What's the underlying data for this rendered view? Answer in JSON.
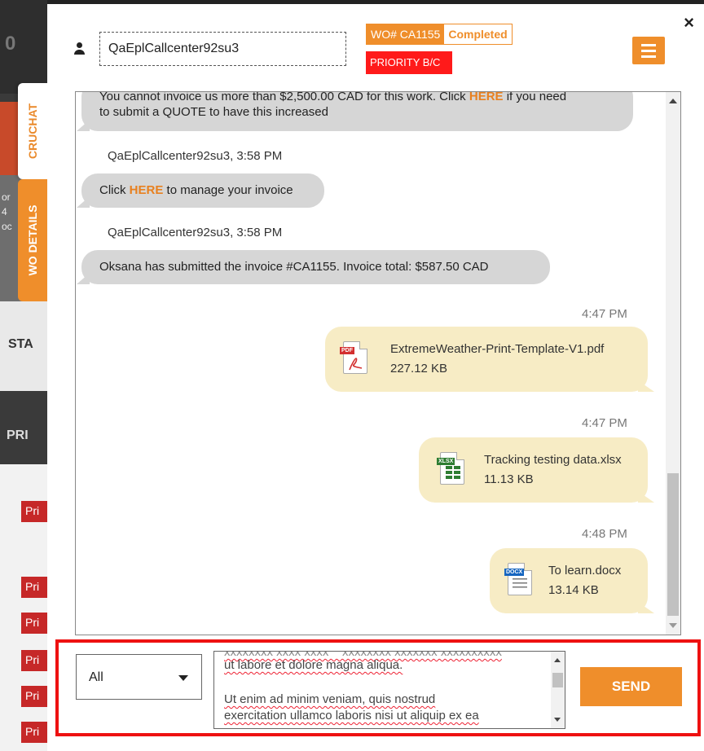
{
  "background": {
    "zero_glyph": "0",
    "side_lines": [
      "or",
      "4",
      "oc"
    ],
    "status_label": "STA",
    "pri_header": "PRI",
    "pri_badges": [
      "Pri",
      "Pri",
      "Pri",
      "Pri",
      "Pri",
      "Pri"
    ]
  },
  "tabs": {
    "cruchat": "CRUCHAT",
    "wo_details": "WO DETAILS"
  },
  "header": {
    "close": "×",
    "user": "QaEplCallcenter92su3",
    "wo_number": "WO# CA1155",
    "wo_status": "Completed",
    "priority": "PRIORITY B/C"
  },
  "messages": {
    "m1_line1_pre": "You cannot invoice us more than $2,500.00 CAD for this work. Click ",
    "m1_here": "HERE",
    "m1_line1_post": " if you need",
    "m1_line2": "to submit a QUOTE to have this increased",
    "s2": "QaEplCallcenter92su3, 3:58 PM",
    "m2_pre": "Click ",
    "m2_here": "HERE",
    "m2_post": " to manage your invoice",
    "s3": "QaEplCallcenter92su3, 3:58 PM",
    "m3": "Oksana has submitted the invoice #CA1155. Invoice total: $587.50 CAD",
    "files": [
      {
        "time": "4:47 PM",
        "name": "ExtremeWeather-Print-Template-V1.pdf",
        "size": "227.12 KB",
        "badge": "PDF",
        "icon": "pdf-file-icon"
      },
      {
        "time": "4:47 PM",
        "name": "Tracking testing data.xlsx",
        "size": "11.13 KB",
        "badge": "XLSX",
        "icon": "xlsx-file-icon"
      },
      {
        "time": "4:48 PM",
        "name": "To learn.docx",
        "size": "13.14 KB",
        "badge": "DOCX",
        "icon": "docx-file-icon"
      }
    ]
  },
  "composer": {
    "select_value": "All",
    "text_lines": [
      "ut labore et dolore magna aliqua.",
      "Ut enim ad minim veniam, quis nostrud",
      "exercitation ullamco laboris nisi ut aliquip ex ea"
    ],
    "send_label": "SEND"
  },
  "colors": {
    "accent": "#ef8e2b",
    "priority": "#ff1a1a",
    "incoming_bubble": "#d6d6d6",
    "outgoing_bubble": "#f7ecc5",
    "highlight_border": "#ee1111"
  }
}
